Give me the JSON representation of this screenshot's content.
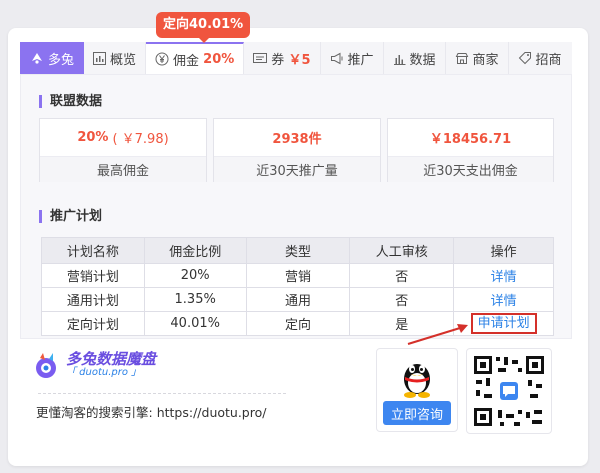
{
  "badge": "定向40.01%",
  "tabs": [
    {
      "label": "多兔",
      "icon": "duotu-logo-icon"
    },
    {
      "label": "概览",
      "icon": "chart-icon"
    },
    {
      "label": "佣金",
      "value": "20%",
      "icon": "yen-icon"
    },
    {
      "label": "券",
      "value": "￥5",
      "icon": "coupon-icon"
    },
    {
      "label": "推广",
      "icon": "megaphone-icon"
    },
    {
      "label": "数据",
      "icon": "bar-chart-icon"
    },
    {
      "label": "商家",
      "icon": "shop-icon"
    },
    {
      "label": "招商",
      "icon": "tag-icon"
    }
  ],
  "alliance": {
    "title": "联盟数据",
    "stats": [
      {
        "value": "20%",
        "sub": "( ￥7.98)",
        "label": "最高佣金"
      },
      {
        "value": "2938件",
        "label": "近30天推广量"
      },
      {
        "value": "￥18456.71",
        "label": "近30天支出佣金"
      }
    ]
  },
  "plans": {
    "title": "推广计划",
    "headers": [
      "计划名称",
      "佣金比例",
      "类型",
      "人工审核",
      "操作"
    ],
    "rows": [
      [
        "营销计划",
        "20%",
        "营销",
        "否",
        "详情"
      ],
      [
        "通用计划",
        "1.35%",
        "通用",
        "否",
        "详情"
      ],
      [
        "定向计划",
        "40.01%",
        "定向",
        "是",
        "申请计划"
      ]
    ]
  },
  "promo": {
    "logo_title": "多兔数据魔盘",
    "logo_url": "「 duotu.pro 」",
    "slogan": "更懂淘客的搜索引擎:",
    "slogan_url": "https://duotu.pro/",
    "consult_button": "立即咨询"
  },
  "colors": {
    "accent": "#8b73f0",
    "red": "#f0553e",
    "link": "#2c82e6",
    "highlight": "#d4302a"
  }
}
